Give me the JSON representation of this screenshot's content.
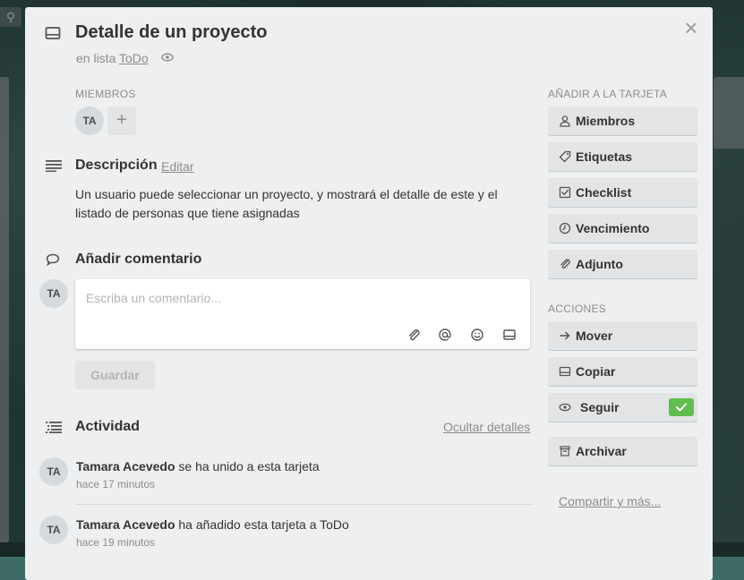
{
  "background": {
    "search_icon": "search-icon"
  },
  "card": {
    "title": "Detalle de un proyecto",
    "list_prefix": "en lista",
    "list_name": "ToDo",
    "close_icon": "close-icon",
    "watch_icon": "eye-icon"
  },
  "members": {
    "label": "MIEMBROS",
    "avatars": [
      "TA"
    ],
    "add_label": "+"
  },
  "description": {
    "heading": "Descripción",
    "edit_label": "Editar",
    "text": "Un usuario puede seleccionar un proyecto, y mostrará el detalle de este y el listado de personas que tiene asignadas"
  },
  "comment": {
    "heading": "Añadir comentario",
    "avatar": "TA",
    "placeholder": "Escriba un comentario...",
    "value": "",
    "tools": [
      "paperclip-icon",
      "at-sign-icon",
      "emoji-icon",
      "card-icon"
    ],
    "save_label": "Guardar"
  },
  "activity": {
    "heading": "Actividad",
    "toggle_label": "Ocultar detalles",
    "items": [
      {
        "avatar": "TA",
        "user": "Tamara Acevedo",
        "action": "se ha unido a esta tarjeta",
        "time": "hace 17 minutos"
      },
      {
        "avatar": "TA",
        "user": "Tamara Acevedo",
        "action": "ha añadido esta tarjeta a ToDo",
        "time": "hace 19 minutos"
      }
    ]
  },
  "sidebar": {
    "add_label": "AÑADIR A LA TARJETA",
    "add_buttons": [
      {
        "label": "Miembros",
        "icon": "person-icon"
      },
      {
        "label": "Etiquetas",
        "icon": "tag-icon"
      },
      {
        "label": "Checklist",
        "icon": "checkbox-icon"
      },
      {
        "label": "Vencimiento",
        "icon": "clock-icon"
      },
      {
        "label": "Adjunto",
        "icon": "paperclip-icon"
      }
    ],
    "actions_label": "ACCIONES",
    "action_buttons": [
      {
        "label": "Mover",
        "icon": "arrow-right-icon"
      },
      {
        "label": "Copiar",
        "icon": "card-icon"
      },
      {
        "label": "Seguir",
        "icon": "eye-icon",
        "active": true
      },
      {
        "label": "Archivar",
        "icon": "archive-icon"
      }
    ],
    "share_label": "Compartir y más..."
  },
  "colors": {
    "modal_bg": "#edeff0",
    "button_bg": "#e2e4e6",
    "check_green": "#61bd4f",
    "muted_text": "#8c8c8c"
  }
}
